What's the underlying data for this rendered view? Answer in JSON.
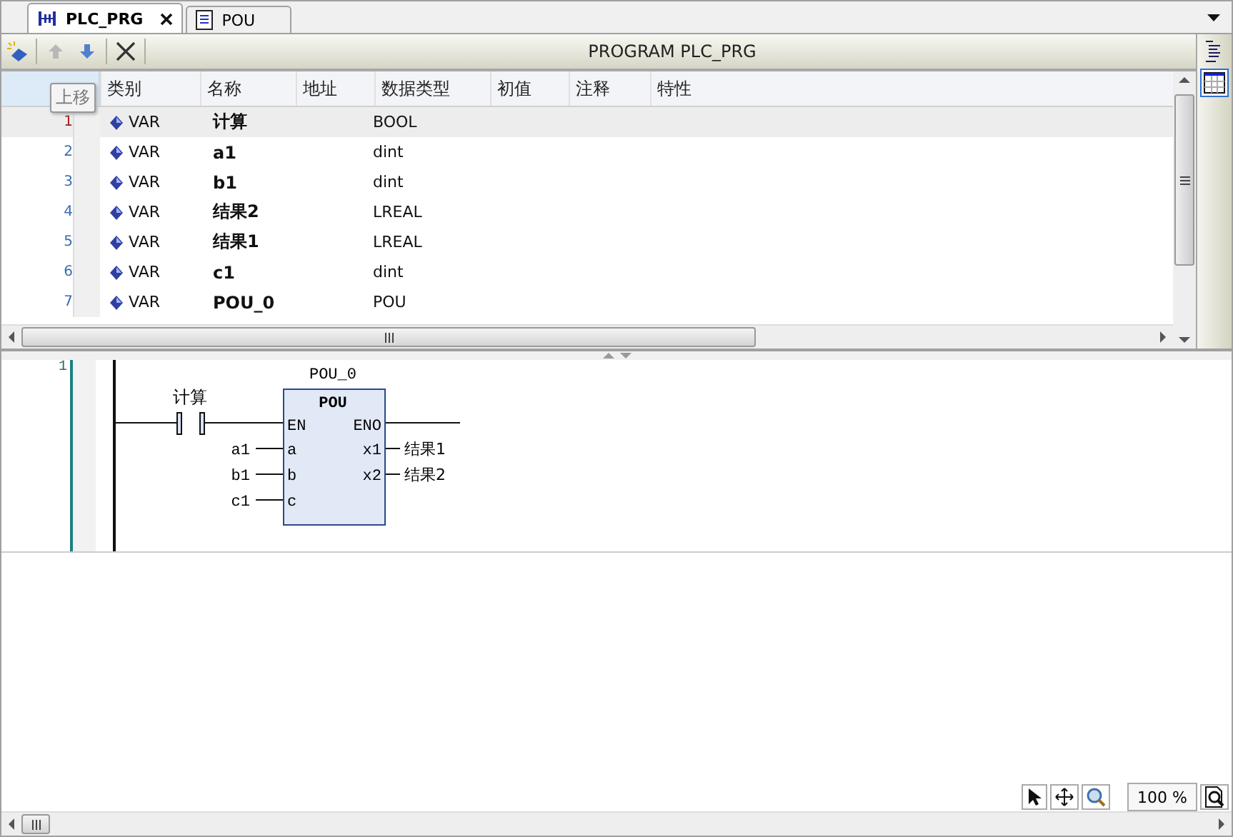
{
  "tabs": [
    {
      "label": "PLC_PRG",
      "kind": "ladder",
      "selected": true,
      "closable": true
    },
    {
      "label": "POU",
      "kind": "text",
      "selected": false,
      "closable": false
    }
  ],
  "toolbar": {
    "title": "PROGRAM PLC_PRG",
    "tooltip": "上移"
  },
  "table": {
    "columns": [
      "类别",
      "名称",
      "地址",
      "数据类型",
      "初值",
      "注释",
      "特性"
    ],
    "rows": [
      {
        "line": "1",
        "class": "VAR",
        "name": "计算",
        "type": "BOOL",
        "selected": true
      },
      {
        "line": "2",
        "class": "VAR",
        "name": "a1",
        "type": "dint",
        "selected": false
      },
      {
        "line": "3",
        "class": "VAR",
        "name": "b1",
        "type": "dint",
        "selected": false
      },
      {
        "line": "4",
        "class": "VAR",
        "name": "结果2",
        "type": "LREAL",
        "selected": false
      },
      {
        "line": "5",
        "class": "VAR",
        "name": "结果1",
        "type": "LREAL",
        "selected": false
      },
      {
        "line": "6",
        "class": "VAR",
        "name": "c1",
        "type": "dint",
        "selected": false
      },
      {
        "line": "7",
        "class": "VAR",
        "name": "POU_0",
        "type": "POU",
        "selected": false
      }
    ]
  },
  "ladder": {
    "network": "1",
    "contact": "计算",
    "instance": "POU_0",
    "block_type": "POU",
    "en": "EN",
    "eno": "ENO",
    "inputs": [
      {
        "pin": "a",
        "var": "a1"
      },
      {
        "pin": "b",
        "var": "b1"
      },
      {
        "pin": "c",
        "var": "c1"
      }
    ],
    "outputs": [
      {
        "pin": "x1",
        "var": "结果1"
      },
      {
        "pin": "x2",
        "var": "结果2"
      }
    ]
  },
  "zoom": "100 %"
}
